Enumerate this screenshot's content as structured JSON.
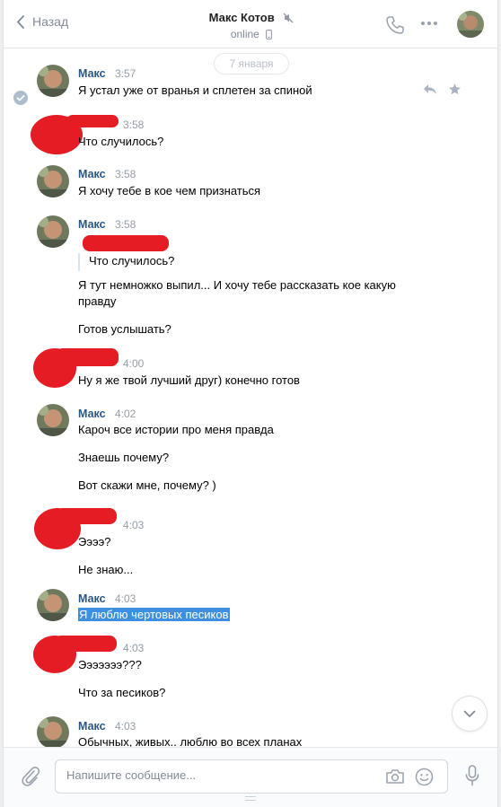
{
  "header": {
    "back_label": "Назад",
    "contact_name": "Макс Котов",
    "status": "online"
  },
  "date_pill": "7 января",
  "messages": [
    {
      "author": "Макс",
      "time": "3:57",
      "lines": [
        "Я устал уже от вранья и сплетен за спиной"
      ]
    },
    {
      "author": "",
      "time": "3:58",
      "lines": [
        "Что случилось?"
      ]
    },
    {
      "author": "Макс",
      "time": "3:58",
      "lines": [
        "Я хочу тебе в кое чем признаться"
      ]
    },
    {
      "author": "Макс",
      "time": "3:58",
      "quote": "Что случилось?",
      "lines": [
        "Я тут немножко выпил... И хочу тебе рассказать кое какую",
        "правду",
        "Готов услышать?"
      ]
    },
    {
      "author": "",
      "time": "4:00",
      "lines": [
        "Ну я же твой лучший друг) конечно готов"
      ]
    },
    {
      "author": "Макс",
      "time": "4:02",
      "lines": [
        "Кароч все истории про меня правда",
        "Знаешь почему?",
        "Вот скажи мне, почему? )"
      ]
    },
    {
      "author": "",
      "time": "4:03",
      "lines": [
        "Ээээ?",
        "Не знаю..."
      ]
    },
    {
      "author": "Макс",
      "time": "4:03",
      "lines": [
        "Я люблю чертовых песиков"
      ]
    },
    {
      "author": "",
      "time": "4:03",
      "lines": [
        "Эээээээ???",
        "Что за песиков?"
      ]
    },
    {
      "author": "Макс",
      "time": "4:03",
      "lines": [
        "Обычных, живых.. люблю во всех планах"
      ]
    }
  ],
  "composer": {
    "placeholder": "Напишите сообщение..."
  },
  "colors": {
    "link_blue": "#2a5885",
    "accent": "#5181b8",
    "muted": "#828a99",
    "redaction": "#e51c23",
    "highlight": "#3e8fe0"
  },
  "icons": [
    "chevron-left-icon",
    "mute-icon",
    "phone-icon",
    "more-icon",
    "check-icon",
    "reply-icon",
    "star-icon",
    "chevron-down-icon",
    "paperclip-icon",
    "camera-icon",
    "smile-icon",
    "microphone-icon"
  ]
}
